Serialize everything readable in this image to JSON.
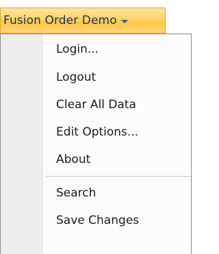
{
  "menu": {
    "title": "Fusion Order Demo",
    "items_group1": [
      "Login...",
      "Logout",
      "Clear All Data",
      "Edit Options...",
      "About"
    ],
    "items_group2": [
      "Search",
      "Save Changes"
    ]
  },
  "icons": {
    "trigger_arrow": "chevron-down-icon"
  },
  "colors": {
    "trigger_highlight": "#ffd46a",
    "trigger_border": "#e2a62c",
    "trigger_text": "#1c2f55",
    "gutter": "#eeeeee",
    "menu_background": "#fcfcfc",
    "menu_border": "#8a8a8a"
  }
}
